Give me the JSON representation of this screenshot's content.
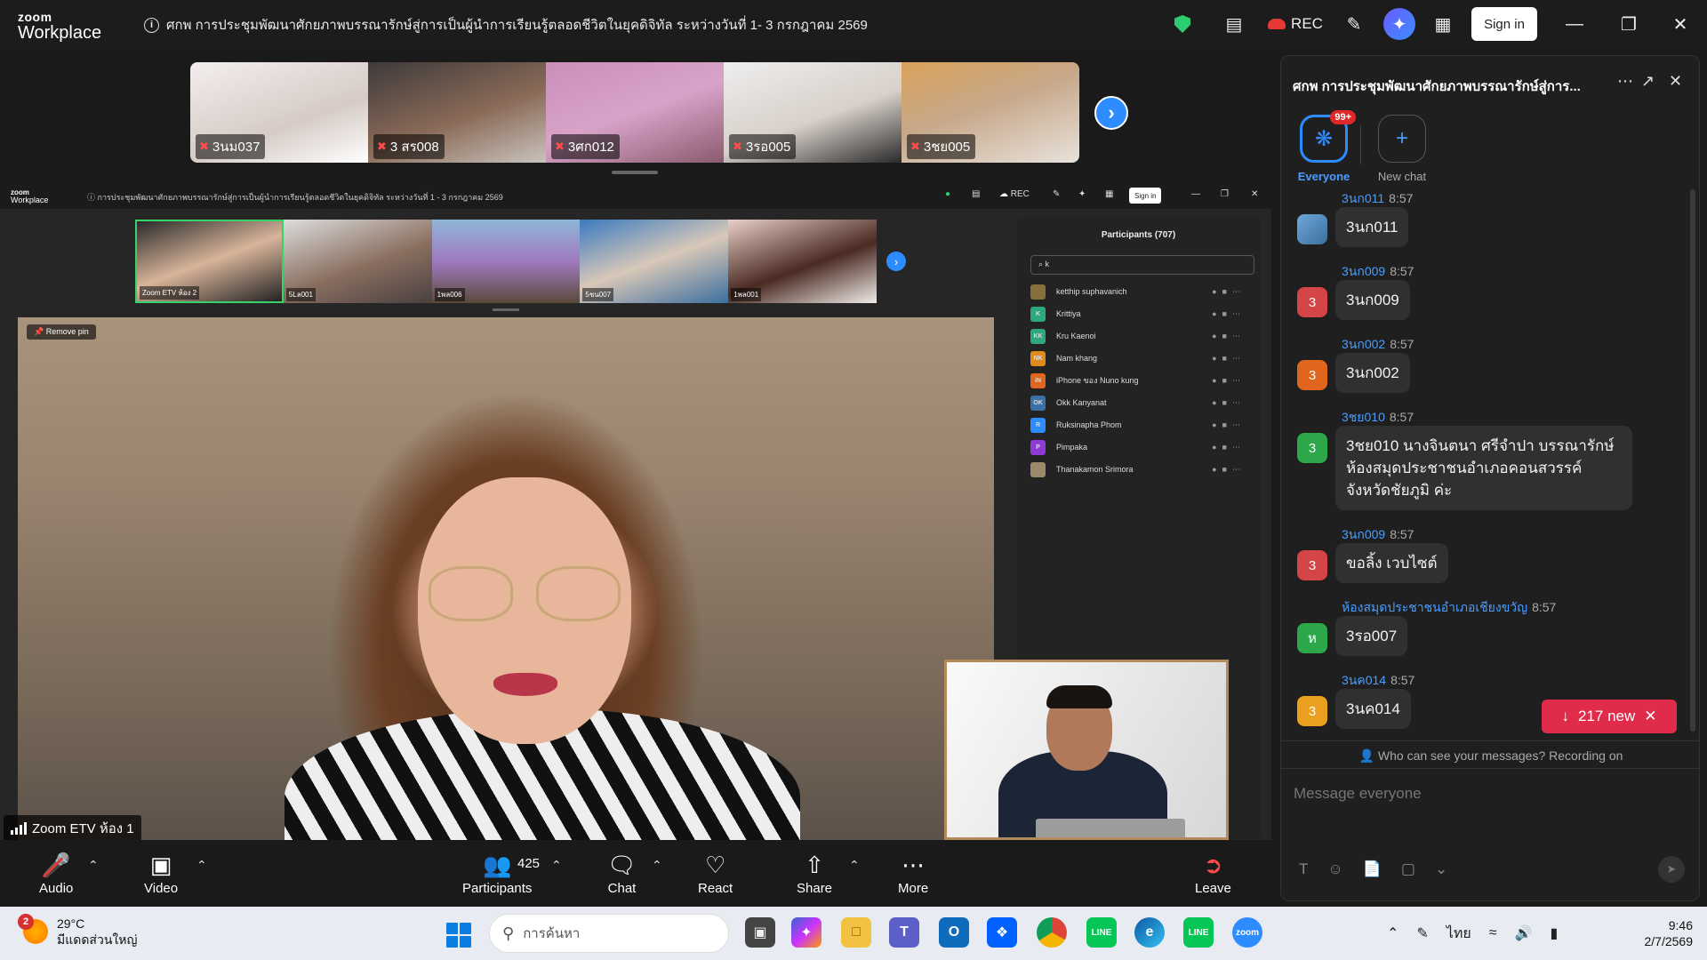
{
  "window": {
    "logo_top": "zoom",
    "logo_bottom": "Workplace",
    "meeting_title": "ศกพ การประชุมพัฒนาศักยภาพบรรณารักษ์สู่การเป็นผู้นำการเรียนรู้ตลอดชีวิตในยุคดิจิทัล  ระหว่างวันที่ 1- 3 กรกฎาคม 2569",
    "rec_label": "REC",
    "signin_label": "Sign in"
  },
  "gallery": [
    {
      "name": "3นม037"
    },
    {
      "name": "3 สร008"
    },
    {
      "name": "3ศก012"
    },
    {
      "name": "3รอ005"
    },
    {
      "name": "3ชย005"
    }
  ],
  "shared_screen": {
    "logo_top": "zoom",
    "logo_bottom": "Workplace",
    "meeting_title": "การประชุมพัฒนาศักยภาพบรรณารักษ์สู่การเป็นผู้นำการเรียนรู้ตลอดชีวิตในยุคดิจิทัล  ระหว่างวันที่ 1 - 3 กรกฎาคม 2569",
    "rec_label": "REC",
    "signin_label": "Sign in",
    "tiles": [
      {
        "name": "Zoom ETV ห้อง 2"
      },
      {
        "name": "5Lล001"
      },
      {
        "name": "1พล006"
      },
      {
        "name": "5ชน007"
      },
      {
        "name": "1พล001"
      }
    ],
    "remove_pin_label": "Remove pin",
    "participants_title": "Participants (707)",
    "search_value": "k",
    "participants": [
      {
        "name": "ketthip suphavanich",
        "initials": "",
        "color": "#8a6f3e"
      },
      {
        "name": "Krittiya",
        "initials": "K",
        "color": "#2ca87a"
      },
      {
        "name": "Kru Kaenoi",
        "initials": "KK",
        "color": "#2ca87a"
      },
      {
        "name": "Nam khang",
        "initials": "NK",
        "color": "#e08a1e"
      },
      {
        "name": "iPhone ของ Nuno kung",
        "initials": "iN",
        "color": "#e0661e"
      },
      {
        "name": "Okk Kanyanat",
        "initials": "OK",
        "color": "#3a6fa8"
      },
      {
        "name": "Ruksinapha Phom",
        "initials": "R",
        "color": "#2d8cff"
      },
      {
        "name": "Pimpaka",
        "initials": "P",
        "color": "#8e3ad6"
      },
      {
        "name": "Thanakamon Srimora",
        "initials": "",
        "color": "#9a8a6a"
      }
    ]
  },
  "speaker_label": "Zoom ETV ห้อง 1",
  "toolbar": {
    "audio": "Audio",
    "video": "Video",
    "participants": "Participants",
    "participants_count": "425",
    "chat": "Chat",
    "react": "React",
    "share": "Share",
    "more": "More",
    "leave": "Leave"
  },
  "chat": {
    "title": "ศกพ การประชุมพัฒนาศักยภาพบรรณารักษ์สู่การ...",
    "tab_everyone": "Everyone",
    "tab_badge": "99+",
    "tab_new_chat": "New chat",
    "messages": [
      {
        "sender": "3นก011",
        "time": "8:57",
        "text": "3นก011",
        "avatar": "",
        "color": "#5b8fc7"
      },
      {
        "sender": "3นก009",
        "time": "8:57",
        "text": "3นก009",
        "avatar": "3",
        "color": "#d64545"
      },
      {
        "sender": "3นก002",
        "time": "8:57",
        "text": "3นก002",
        "avatar": "3",
        "color": "#e0661e"
      },
      {
        "sender": "3ชย010",
        "time": "8:57",
        "text": "3ชย010 นางจินตนา ศรีจำปา บรรณารักษ์ ห้องสมุดประชาชนอำเภอคอนสวรรค์ จังหวัดชัยภูมิ ค่ะ",
        "avatar": "3",
        "color": "#2ca84a"
      },
      {
        "sender": "3นก009",
        "time": "8:57",
        "text": "ขอลิ้ง เวบไซต์",
        "avatar": "3",
        "color": "#d64545"
      },
      {
        "sender": "ห้องสมุดประชาชนอำเภอเชียงขวัญ",
        "time": "8:57",
        "text": "3รอ007",
        "avatar": "ห",
        "color": "#2ca84a"
      },
      {
        "sender": "3นค014",
        "time": "8:57",
        "text": "3นค014",
        "avatar": "3",
        "color": "#e8a01e"
      }
    ],
    "new_messages_label": "217 new",
    "visibility_note": "Who can see your messages? Recording on",
    "input_placeholder": "Message everyone"
  },
  "taskbar": {
    "weather_temp": "29°C",
    "weather_desc": "มีแดดส่วนใหญ่",
    "weather_badge": "2",
    "search_placeholder": "การค้นหา",
    "language": "ไทย",
    "time": "9:46",
    "date": "2/7/2569"
  }
}
